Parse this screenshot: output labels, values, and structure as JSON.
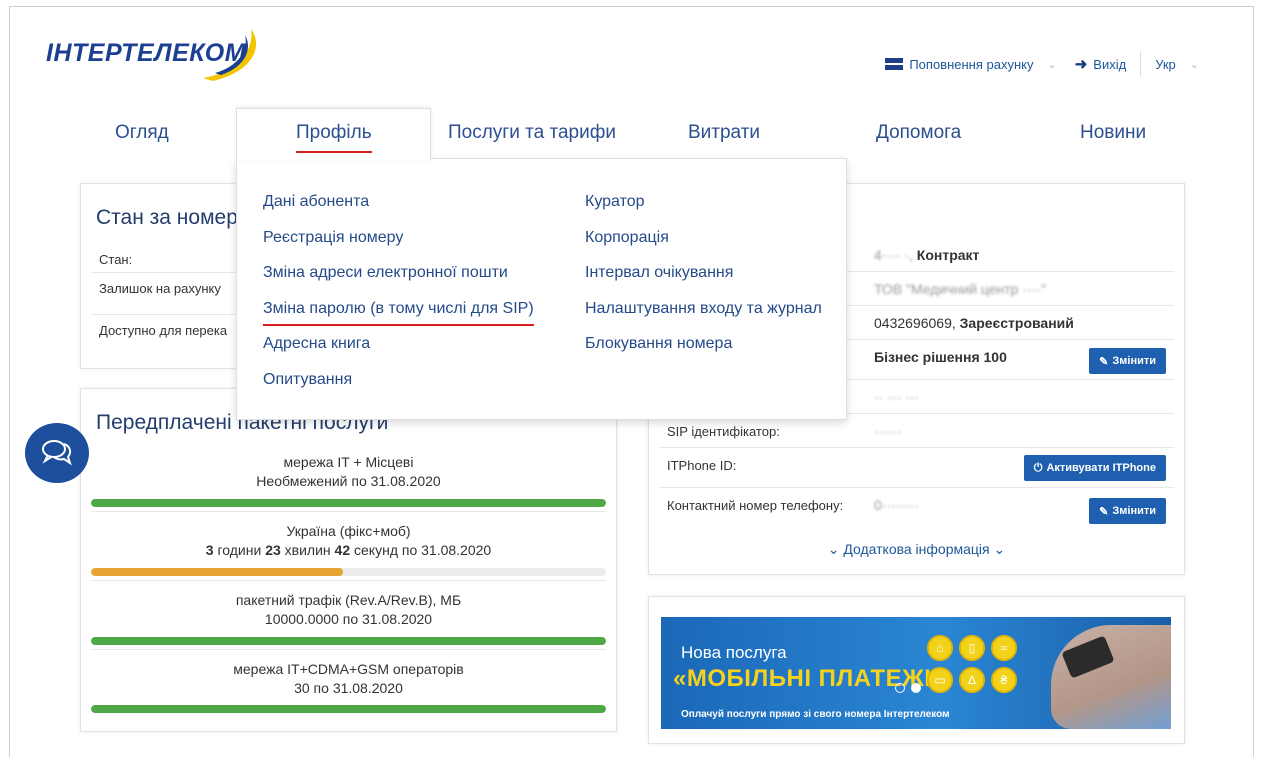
{
  "brand": {
    "logo_text": "ІНТЕРТЕЛЕКОМ"
  },
  "topbar": {
    "topup": "Поповнення рахунку",
    "logout": "Вихід",
    "lang": "Укр"
  },
  "nav": {
    "tabs": [
      "Огляд",
      "Профіль",
      "Послуги та тарифи",
      "Витрати",
      "Допомога",
      "Новини"
    ]
  },
  "menu": {
    "col1": [
      "Дані абонента",
      "Реєстрація номеру",
      "Зміна адреси електронної пошти",
      "Зміна паролю (в тому числі для SIP)",
      "Адресна книга",
      "Опитування"
    ],
    "col2": [
      "Куратор",
      "Корпорація",
      "Інтервал очікування",
      "Налаштування входу та журнал",
      "Блокування номера"
    ]
  },
  "status_card": {
    "title": "Стан за номер",
    "rows": [
      "Стан:",
      "Залишок на рахунку",
      "Доступно для перека"
    ]
  },
  "packages_card": {
    "title": "Передплачені пакетні послуги",
    "items": [
      {
        "l1": "мережа IT + Місцеві",
        "l2": "Необмежений по 31.08.2020",
        "progress": 1.0,
        "color": "#4ea845"
      },
      {
        "l1": "Україна (фікс+моб)",
        "l2_parts": [
          "3",
          " години ",
          "23",
          " хвилин ",
          "42",
          " секунд по 31.08.2020"
        ],
        "progress": 0.49,
        "color": "#e6a532"
      },
      {
        "l1": "пакетний трафік (Rev.A/Rev.B), МБ",
        "l2": "10000.0000 по 31.08.2020",
        "progress": 1.0,
        "color": "#4ea845"
      },
      {
        "l1": "мережа IT+CDMA+GSM операторів",
        "l2": "30 по 31.08.2020",
        "progress": 1.0,
        "color": "#4ea845"
      }
    ]
  },
  "info_card": {
    "contract_val": "Контракт",
    "contract_blur": "4···· ·,",
    "org_blur": "ТОВ \"Медичний центр ····\"",
    "number_prefix": "0432696069, ",
    "number_status": "Зареєстрований",
    "tariff": "Бізнес рішення 100",
    "change": "Змінити",
    "blur_row": "·· ··· ···",
    "sip_label": "SIP ідентифікатор:",
    "sip_blur": "······",
    "itphone_label": "ITPhone ID:",
    "activate": "Активувати ITPhone",
    "contact_label": "Контактний номер телефону:",
    "contact_blur": "0········",
    "more": "Додаткова інформація"
  },
  "banner": {
    "t1": "Нова послуга",
    "t2": "«МОБІЛЬНІ ПЛАТЕЖІ»",
    "t3": "Оплачуй послуги прямо зі свого номера Інтертелеком"
  }
}
